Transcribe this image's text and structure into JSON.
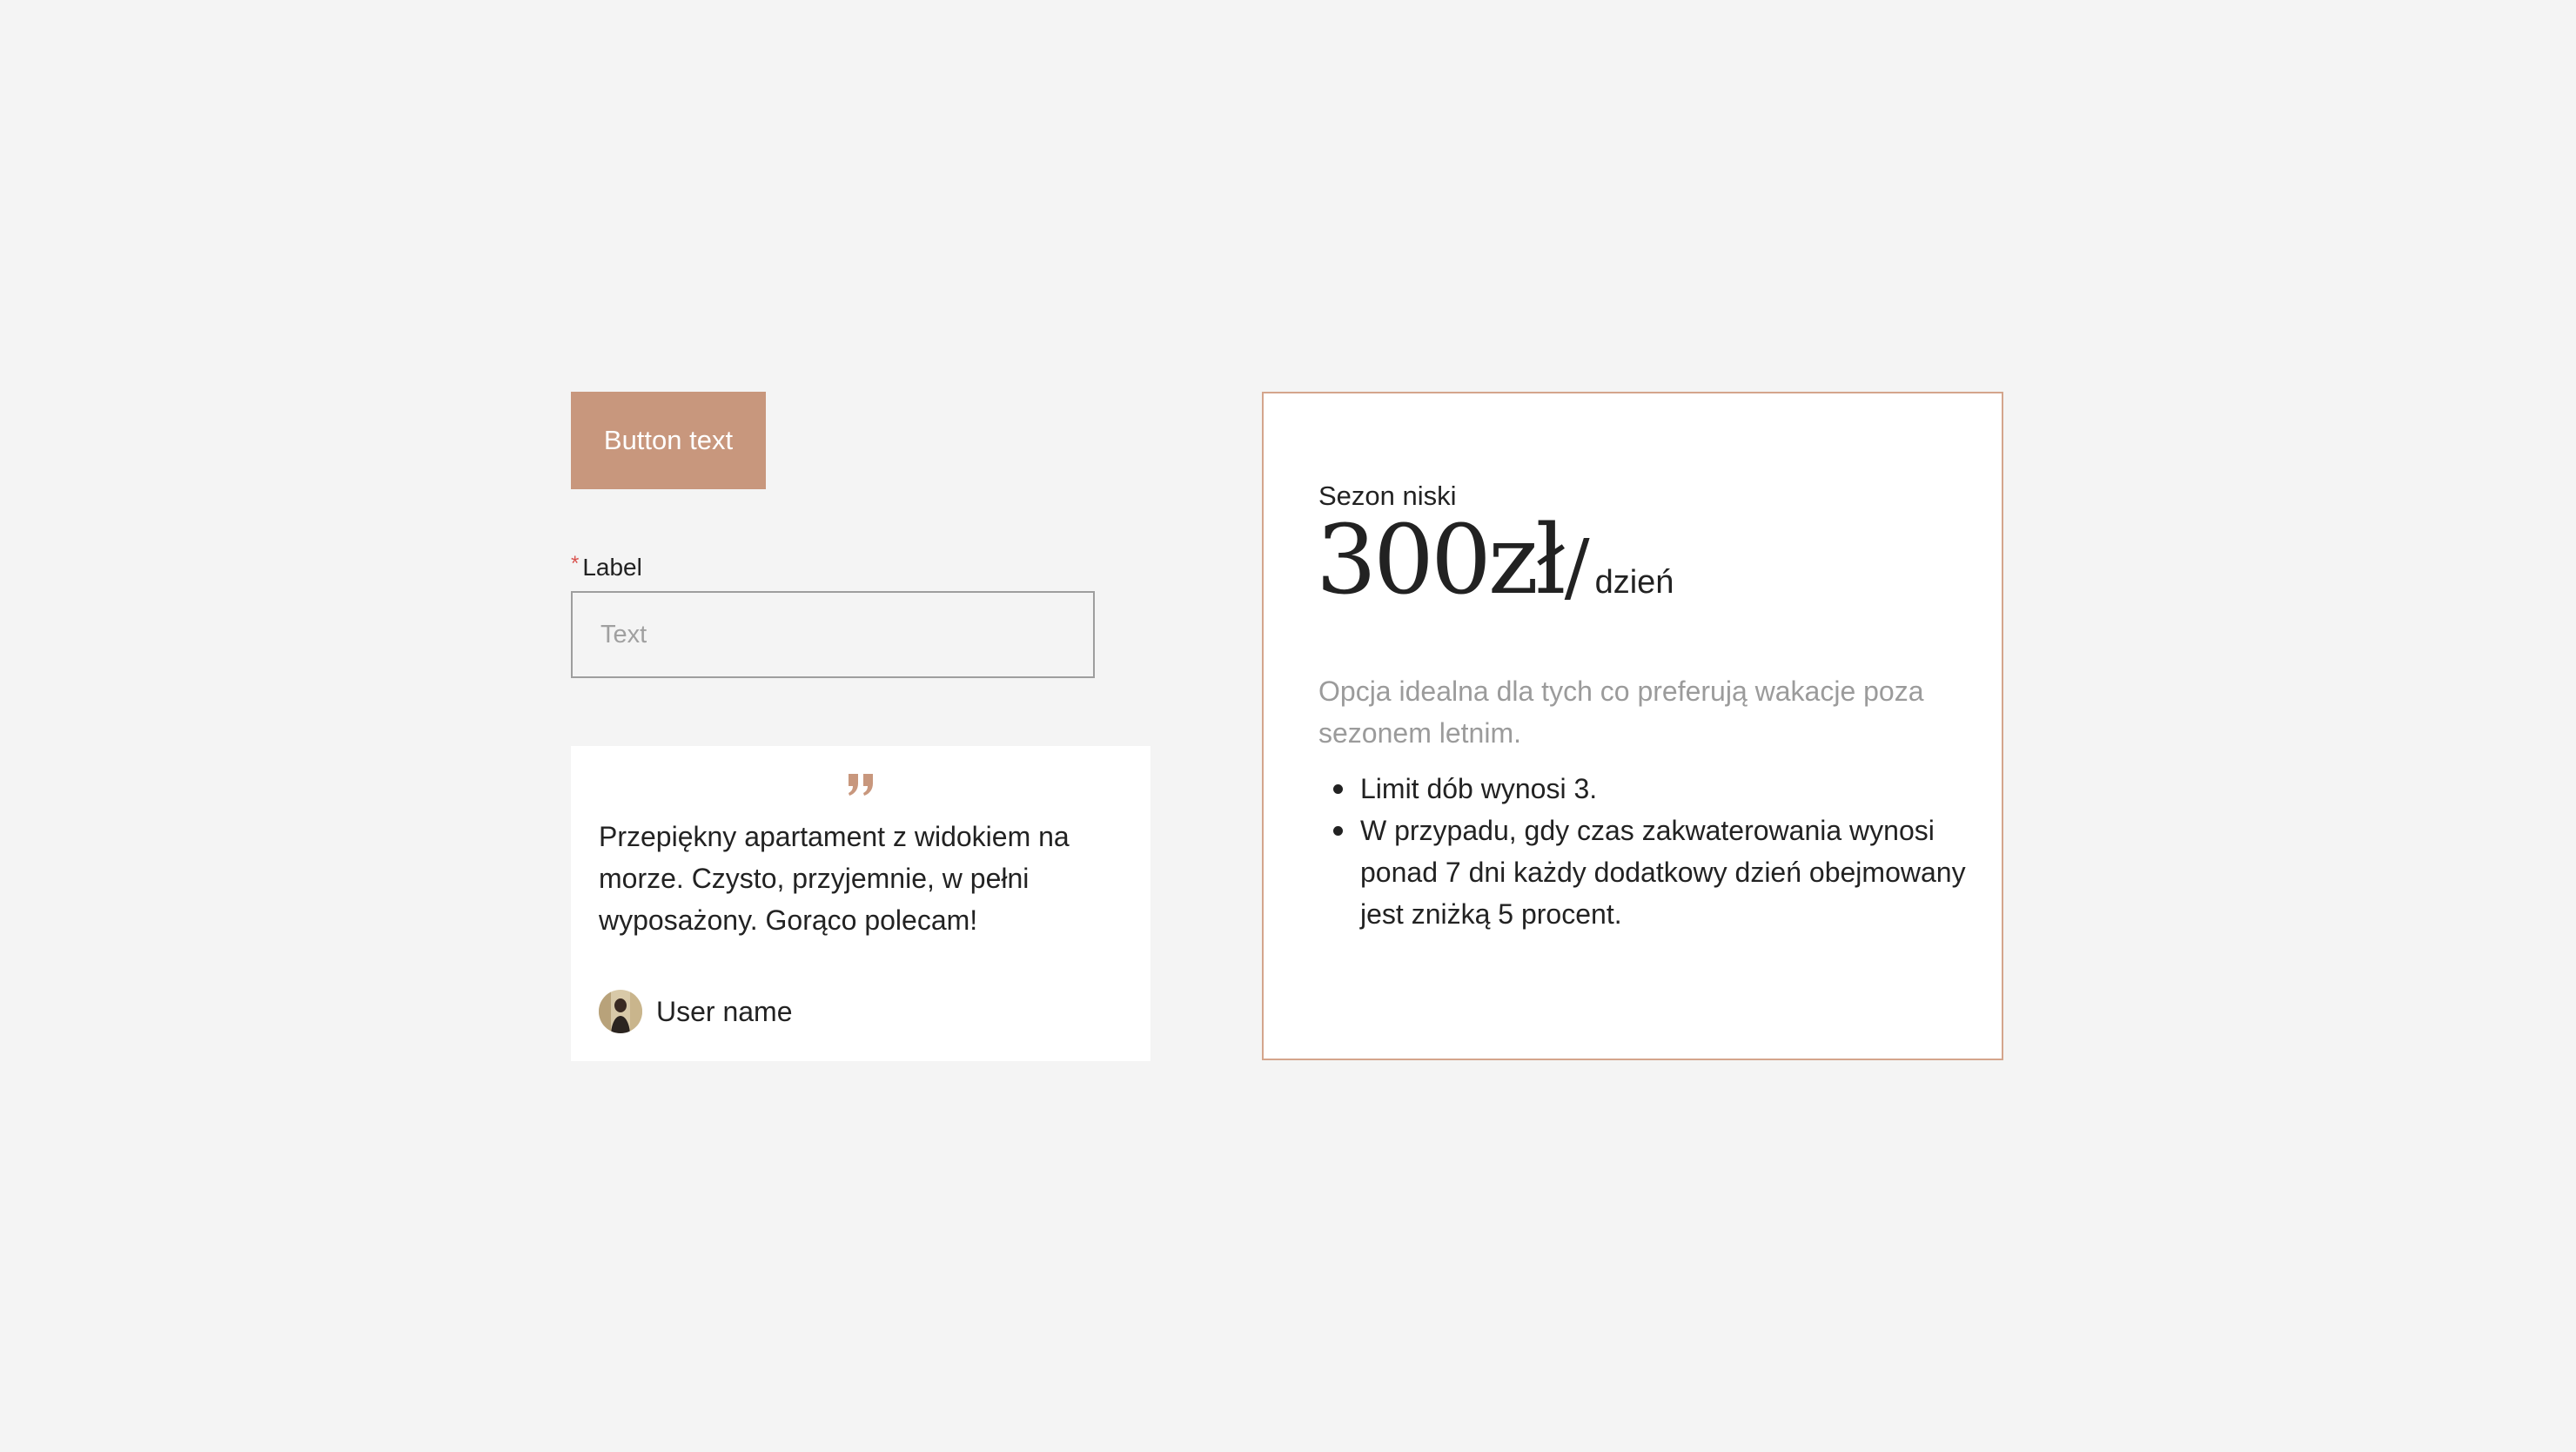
{
  "button": {
    "label": "Button text"
  },
  "field": {
    "required_marker": "*",
    "label": "Label",
    "placeholder": "Text",
    "value": ""
  },
  "testimonial": {
    "quote_icon": "closing-quote-icon",
    "text": "Przepiękny apartament z widokiem na morze. Czysto, przyjemnie, w pełni wyposażony. Gorąco polecam!",
    "user_name": "User name"
  },
  "pricing": {
    "season": "Sezon niski",
    "price": "300zł",
    "separator": "/",
    "unit": "dzień",
    "description": "Opcja idealna dla tych co preferują wakacje poza sezonem letnim.",
    "features": [
      "Limit dób wynosi 3.",
      "W przypadu, gdy czas zakwaterowania wynosi ponad 7 dni każdy dodatkowy dzień obejmowany jest zniżką 5 procent."
    ]
  },
  "colors": {
    "background": "#f4f4f4",
    "accent": "#c8977d",
    "card_border": "#d4a58c",
    "required": "#d9534f",
    "muted_text": "#9b9b9b",
    "text": "#222222"
  }
}
